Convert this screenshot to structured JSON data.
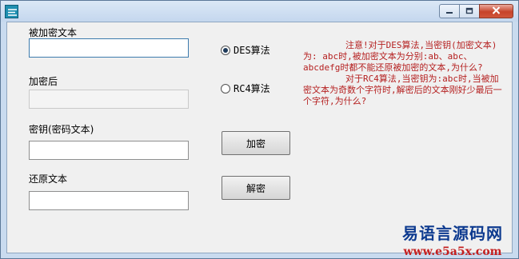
{
  "window": {
    "buttons": {
      "minimize": "minimize-icon",
      "maximize": "maximize-icon",
      "close": "close-icon"
    }
  },
  "form": {
    "plaintext_label": "被加密文本",
    "plaintext_value": "",
    "ciphertext_label": "加密后",
    "ciphertext_value": "",
    "key_label": "密钥(密码文本)",
    "key_value": "",
    "restored_label": "还原文本",
    "restored_value": ""
  },
  "algorithms": [
    {
      "label": "DES算法",
      "checked": true
    },
    {
      "label": "RC4算法",
      "checked": false
    }
  ],
  "buttons": {
    "encrypt": "加密",
    "decrypt": "解密"
  },
  "note": "        注意!对于DES算法,当密钥(加密文本)为: abc时,被加密文本为分别:ab、abc、abcdefg时都不能还原被加密的文本,为什么?\n        对于RC4算法,当密钥为:abc时,当被加密文本为奇数个字符时,解密后的文本刚好少最后一个字符,为什么?",
  "watermark": {
    "name": "易语言源码网",
    "url": "www.e5a5x.com"
  }
}
